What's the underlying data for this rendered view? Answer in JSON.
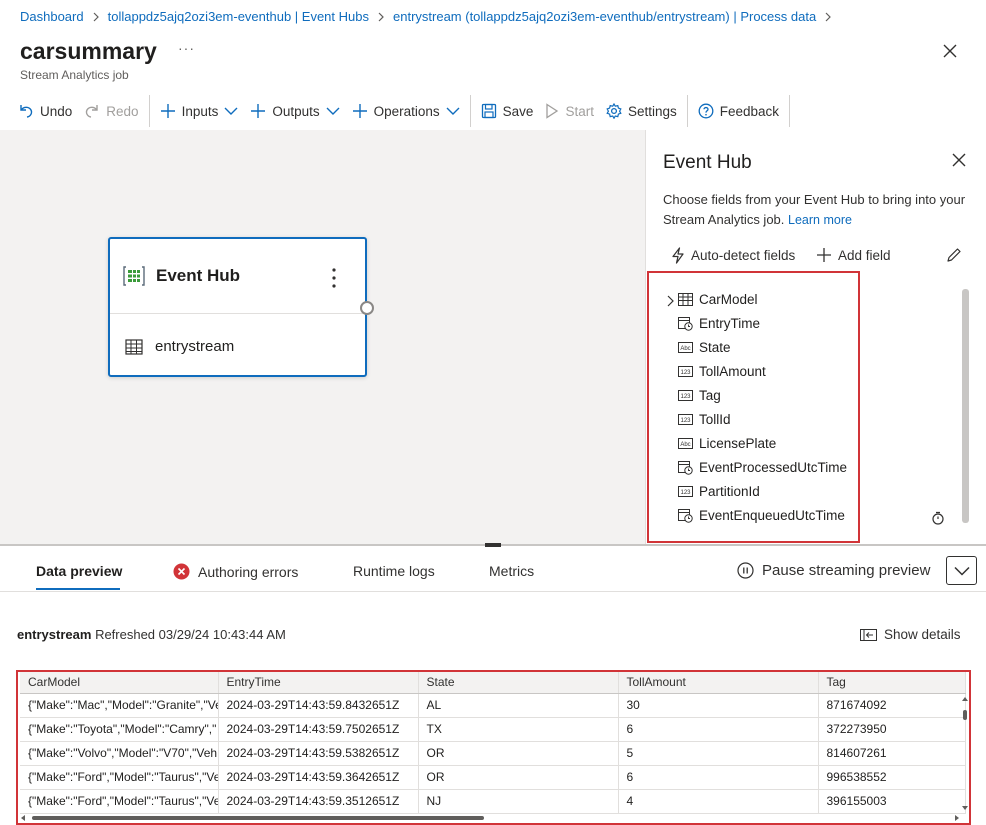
{
  "breadcrumb": [
    "Dashboard",
    "tollappdz5ajq2ozi3em-eventhub | Event Hubs",
    "entrystream (tollappdz5ajq2ozi3em-eventhub/entrystream) | Process data"
  ],
  "header": {
    "title": "carsummary",
    "subtitle": "Stream Analytics job",
    "more": "···"
  },
  "toolbar": {
    "undo": "Undo",
    "redo": "Redo",
    "inputs": "Inputs",
    "outputs": "Outputs",
    "operations": "Operations",
    "save": "Save",
    "start": "Start",
    "settings": "Settings",
    "feedback": "Feedback"
  },
  "node": {
    "title": "Event Hub",
    "stream": "entrystream"
  },
  "panel": {
    "title": "Event Hub",
    "description": "Choose fields from your Event Hub to bring into your Stream Analytics job.",
    "learn_more": "Learn more",
    "autodetect": "Auto-detect fields",
    "add_field": "Add field",
    "fields": [
      {
        "name": "CarModel",
        "icon": "record-icon"
      },
      {
        "name": "EntryTime",
        "icon": "datetime-icon"
      },
      {
        "name": "State",
        "icon": "string-icon"
      },
      {
        "name": "TollAmount",
        "icon": "number-icon"
      },
      {
        "name": "Tag",
        "icon": "number-icon"
      },
      {
        "name": "TollId",
        "icon": "number-icon"
      },
      {
        "name": "LicensePlate",
        "icon": "string-icon"
      },
      {
        "name": "EventProcessedUtcTime",
        "icon": "datetime-icon"
      },
      {
        "name": "PartitionId",
        "icon": "number-icon"
      },
      {
        "name": "EventEnqueuedUtcTime",
        "icon": "datetime-icon"
      }
    ]
  },
  "tabs": [
    "Data preview",
    "Authoring errors",
    "Runtime logs",
    "Metrics"
  ],
  "pause_label": "Pause streaming preview",
  "preview": {
    "source": "entrystream",
    "refreshed": "Refreshed 03/29/24 10:43:44 AM",
    "show_details": "Show details"
  },
  "grid": {
    "columns": [
      "CarModel",
      "EntryTime",
      "State",
      "TollAmount",
      "Tag"
    ],
    "rows": [
      [
        "{\"Make\":\"Mac\",\"Model\":\"Granite\",\"Ve",
        "2024-03-29T14:43:59.8432651Z",
        "AL",
        "30",
        "871674092"
      ],
      [
        "{\"Make\":\"Toyota\",\"Model\":\"Camry\",\"",
        "2024-03-29T14:43:59.7502651Z",
        "TX",
        "6",
        "372273950"
      ],
      [
        "{\"Make\":\"Volvo\",\"Model\":\"V70\",\"Veh",
        "2024-03-29T14:43:59.5382651Z",
        "OR",
        "5",
        "814607261"
      ],
      [
        "{\"Make\":\"Ford\",\"Model\":\"Taurus\",\"Ve",
        "2024-03-29T14:43:59.3642651Z",
        "OR",
        "6",
        "996538552"
      ],
      [
        "{\"Make\":\"Ford\",\"Model\":\"Taurus\",\"Ve",
        "2024-03-29T14:43:59.3512651Z",
        "NJ",
        "4",
        "396155003"
      ]
    ]
  },
  "colors": {
    "accent": "#0f6cbd",
    "highlight": "#d13438",
    "error": "#d13438"
  }
}
